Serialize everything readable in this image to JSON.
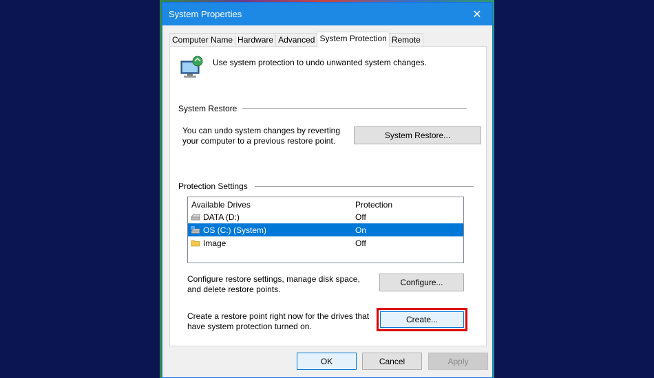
{
  "window": {
    "title": "System Properties",
    "close_glyph": "✕",
    "accent": "#1e88e5"
  },
  "tabs": [
    {
      "label": "Computer Name"
    },
    {
      "label": "Hardware"
    },
    {
      "label": "Advanced"
    },
    {
      "label": "System Protection",
      "active": true
    },
    {
      "label": "Remote"
    }
  ],
  "intro": {
    "text": "Use system protection to undo unwanted system changes.",
    "icon": "system-protection-icon"
  },
  "system_restore": {
    "heading": "System Restore",
    "description_line1": "You can undo system changes by reverting",
    "description_line2": "your computer to a previous restore point.",
    "button_label": "System Restore..."
  },
  "protection_settings": {
    "heading": "Protection Settings",
    "columns": [
      "Available Drives",
      "Protection"
    ],
    "drives": [
      {
        "name": "DATA (D:)",
        "protection": "Off",
        "icon": "drive-icon"
      },
      {
        "name": "OS (C:) (System)",
        "protection": "On",
        "icon": "system-drive-icon",
        "selected": true
      },
      {
        "name": "Image",
        "protection": "Off",
        "icon": "folder-icon"
      }
    ],
    "configure_text_line1": "Configure restore settings, manage disk space,",
    "configure_text_line2": "and delete restore points.",
    "configure_button": "Configure...",
    "create_text_line1": "Create a restore point right now for the drives that",
    "create_text_line2": "have system protection turned on.",
    "create_button": "Create...",
    "highlight_color": "#e00000"
  },
  "footer": {
    "ok": "OK",
    "cancel": "Cancel",
    "apply": "Apply"
  }
}
